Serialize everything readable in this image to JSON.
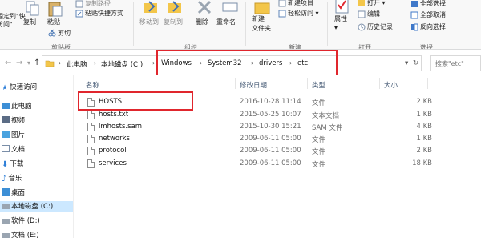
{
  "ribbon": {
    "clipboard": {
      "pin_label": "固定到\"快\n访问\"",
      "copy_label": "复制",
      "paste_label": "粘贴",
      "copy_path_label": "复制路径",
      "paste_shortcut_label": "粘贴快捷方式",
      "cut_label": "剪切",
      "group_label": "剪贴板"
    },
    "organize": {
      "move_to_label": "移动到",
      "copy_to_label": "复制到",
      "delete_label": "删除",
      "rename_label": "重命名",
      "group_label": "组织"
    },
    "new": {
      "new_folder_label": "新建\n文件夹",
      "new_item_label": "新建项目",
      "easy_access_label": "轻松访问",
      "group_label": "新建"
    },
    "open": {
      "properties_label": "属性",
      "open_label": "打开",
      "edit_label": "编辑",
      "history_label": "历史记录",
      "group_label": "打开"
    },
    "select": {
      "select_all_label": "全部选择",
      "select_none_label": "全部取消",
      "invert_label": "反向选择",
      "group_label": "选择"
    }
  },
  "address": {
    "crumbs": [
      "此电脑",
      "本地磁盘 (C:)",
      "Windows",
      "System32",
      "drivers",
      "etc"
    ],
    "search_placeholder": "搜索\"etc\""
  },
  "nav": {
    "items": [
      {
        "label": "快速访问",
        "icon": "star-icon"
      },
      {
        "label": "此电脑",
        "icon": "computer-icon"
      },
      {
        "label": "视频",
        "icon": "video-folder-icon"
      },
      {
        "label": "图片",
        "icon": "pictures-folder-icon"
      },
      {
        "label": "文档",
        "icon": "documents-folder-icon"
      },
      {
        "label": "下载",
        "icon": "download-icon"
      },
      {
        "label": "音乐",
        "icon": "music-icon"
      },
      {
        "label": "桌面",
        "icon": "desktop-folder-icon"
      },
      {
        "label": "本地磁盘 (C:)",
        "icon": "drive-icon"
      },
      {
        "label": "软件 (D:)",
        "icon": "drive-icon"
      },
      {
        "label": "文档 (E:)",
        "icon": "drive-icon"
      }
    ]
  },
  "files": {
    "headers": {
      "name": "名称",
      "date": "修改日期",
      "type": "类型",
      "size": "大小"
    },
    "rows": [
      {
        "name": "HOSTS",
        "date": "2016-10-28 11:14",
        "type": "文件",
        "size": "2 KB"
      },
      {
        "name": "hosts.txt",
        "date": "2015-05-25 10:07",
        "type": "文本文档",
        "size": "1 KB"
      },
      {
        "name": "lmhosts.sam",
        "date": "2015-10-30 15:21",
        "type": "SAM 文件",
        "size": "4 KB"
      },
      {
        "name": "networks",
        "date": "2009-06-11 05:00",
        "type": "文件",
        "size": "1 KB"
      },
      {
        "name": "protocol",
        "date": "2009-06-11 05:00",
        "type": "文件",
        "size": "2 KB"
      },
      {
        "name": "services",
        "date": "2009-06-11 05:00",
        "type": "文件",
        "size": "18 KB"
      }
    ]
  },
  "colors": {
    "highlight_red": "#e0262d",
    "selected_blue": "#cce8ff",
    "folder_yellow": "#f3c64a"
  }
}
